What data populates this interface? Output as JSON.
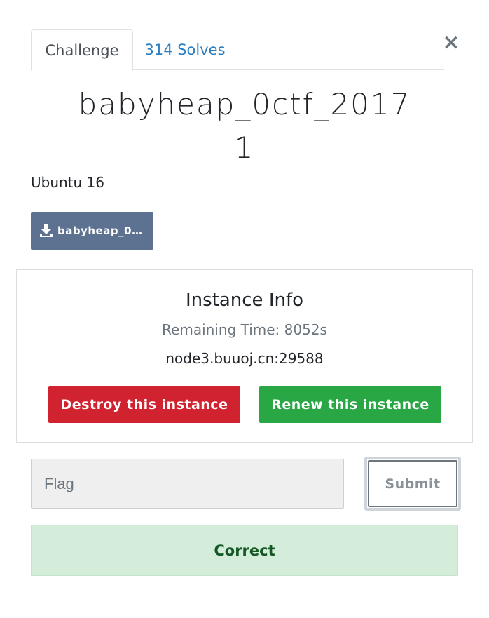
{
  "tabs": {
    "challenge_label": "Challenge",
    "solves_label": "314 Solves"
  },
  "close_symbol": "×",
  "challenge": {
    "name_line1": "babyheap_0ctf_2017",
    "name_line2": "1",
    "description": "Ubuntu 16",
    "file_label": "babyheap_0c...",
    "file_icon": "download-icon"
  },
  "instance": {
    "title": "Instance Info",
    "remaining": "Remaining Time: 8052s",
    "host": "node3.buuoj.cn:29588",
    "destroy_label": "Destroy this instance",
    "renew_label": "Renew this instance"
  },
  "flag_form": {
    "placeholder": "Flag",
    "value": "",
    "submit_label": "Submit"
  },
  "result": {
    "message": "Correct"
  },
  "colors": {
    "link": "#2c7fc1",
    "file_button": "#5d7290",
    "destroy": "#d0232f",
    "renew": "#29a745",
    "success_bg": "#d4edda",
    "success_text": "#155724"
  }
}
